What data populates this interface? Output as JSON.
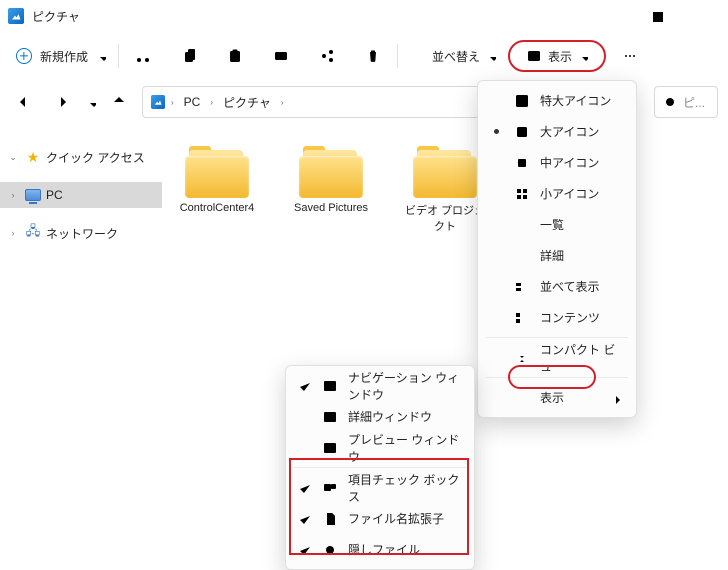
{
  "window": {
    "title": "ピクチャ"
  },
  "toolbar": {
    "new_label": "新規作成",
    "sort_label": "並べ替え",
    "view_label": "表示"
  },
  "address": {
    "segments": [
      "PC",
      "ピクチャ"
    ]
  },
  "search": {
    "placeholder": "ピ..."
  },
  "nav": {
    "items": [
      {
        "label": "クイック アクセス",
        "icon": "star"
      },
      {
        "label": "PC",
        "icon": "pc",
        "selected": true
      },
      {
        "label": "ネットワーク",
        "icon": "net"
      }
    ]
  },
  "content": {
    "items": [
      {
        "label": "ControlCenter4",
        "kind": "folder"
      },
      {
        "label": "Saved Pictures",
        "kind": "folder"
      },
      {
        "label": "ビデオ プロジェクト",
        "kind": "folder"
      },
      {
        "label": "",
        "kind": "image"
      }
    ]
  },
  "view_menu": {
    "groups": [
      [
        {
          "label": "特大アイコン",
          "icon": "layout-xl"
        },
        {
          "label": "大アイコン",
          "icon": "layout-lg",
          "checked": true
        },
        {
          "label": "中アイコン",
          "icon": "layout-md"
        },
        {
          "label": "小アイコン",
          "icon": "layout-sm"
        },
        {
          "label": "一覧",
          "icon": "list"
        },
        {
          "label": "詳細",
          "icon": "details"
        },
        {
          "label": "並べて表示",
          "icon": "tiles"
        },
        {
          "label": "コンテンツ",
          "icon": "content"
        }
      ],
      [
        {
          "label": "コンパクト ビュー",
          "icon": "compact"
        }
      ],
      [
        {
          "label": "表示",
          "submenu": true
        }
      ]
    ]
  },
  "show_submenu": {
    "items": [
      {
        "label": "ナビゲーション ウィンドウ",
        "icon": "nav-pane",
        "checked": true
      },
      {
        "label": "詳細ウィンドウ",
        "icon": "detail-pane"
      },
      {
        "label": "プレビュー ウィンドウ",
        "icon": "preview-pane"
      },
      {
        "label": "項目チェック ボックス",
        "icon": "checkbox",
        "checked": true
      },
      {
        "label": "ファイル名拡張子",
        "icon": "file-ext",
        "checked": true
      },
      {
        "label": "隠しファイル",
        "icon": "hidden",
        "checked": true
      }
    ]
  }
}
